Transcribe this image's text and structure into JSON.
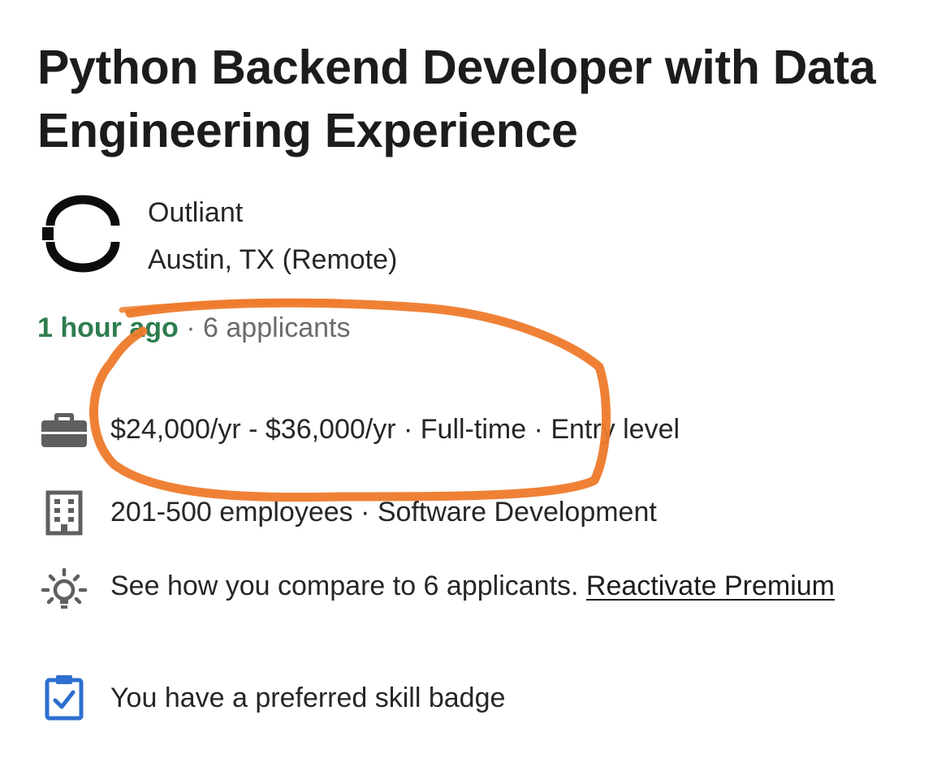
{
  "job": {
    "title": "Python Backend Developer with Data Engineering Experience"
  },
  "company": {
    "name": "Outliant",
    "location": "Austin, TX (Remote)",
    "logo_icon": "outliant-logo-icon"
  },
  "meta": {
    "posted": "1 hour ago",
    "separator": "·",
    "applicants": "6 applicants"
  },
  "details": {
    "salary_line": "$24,000/yr - $36,000/yr · Full-time · Entry level",
    "company_size_line": "201-500 employees · Software Development",
    "insight_text": "See how you compare to 6 applicants. ",
    "insight_link": "Reactivate Premium",
    "skill_badge_text": "You have a preferred skill badge"
  },
  "icons": {
    "salary": "briefcase-icon",
    "company_size": "building-icon",
    "insight": "lightbulb-icon",
    "skill_badge": "clipboard-check-icon"
  },
  "colors": {
    "posted_green": "#2e7d4f",
    "muted_gray": "#6b6b6b",
    "icon_gray": "#5f5f5f",
    "badge_blue": "#2d6fd0",
    "annotation_orange": "#ee7a2b"
  }
}
